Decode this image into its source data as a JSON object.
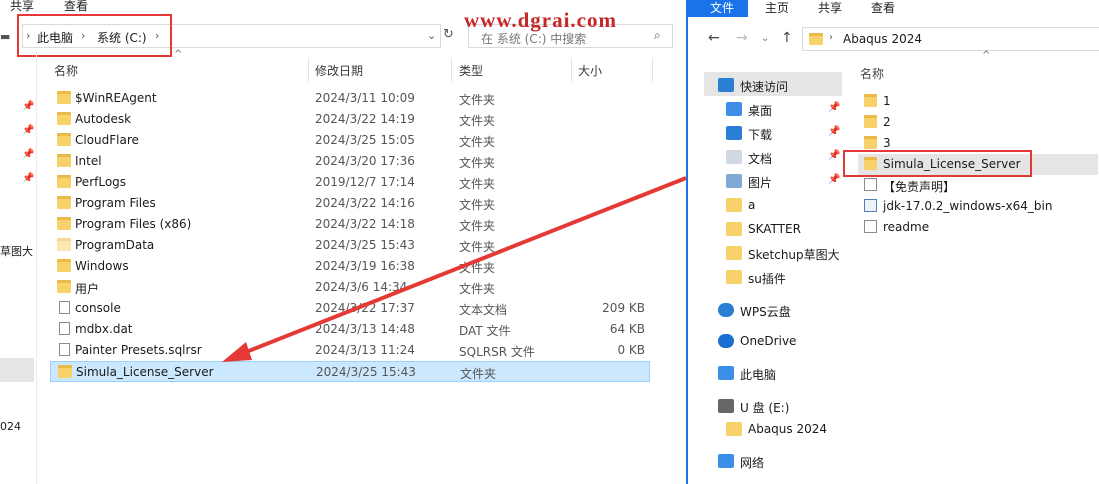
{
  "watermark": "www.dgrai.com",
  "left": {
    "ribbon": {
      "share": "共享",
      "view": "查看"
    },
    "breadcrumb": [
      "此电脑",
      "系统 (C:)"
    ],
    "search_placeholder": "在 系统 (C:) 中搜索",
    "columns": {
      "name": "名称",
      "date": "修改日期",
      "type": "类型",
      "size": "大小"
    },
    "side_fragments": [
      "草图大",
      "024"
    ],
    "files": [
      {
        "name": "$WinREAgent",
        "date": "2024/3/11 10:09",
        "type": "文件夹",
        "size": "",
        "icon": "folder"
      },
      {
        "name": "Autodesk",
        "date": "2024/3/22 14:19",
        "type": "文件夹",
        "size": "",
        "icon": "folder"
      },
      {
        "name": "CloudFlare",
        "date": "2024/3/25 15:05",
        "type": "文件夹",
        "size": "",
        "icon": "folder"
      },
      {
        "name": "Intel",
        "date": "2024/3/20 17:36",
        "type": "文件夹",
        "size": "",
        "icon": "folder"
      },
      {
        "name": "PerfLogs",
        "date": "2019/12/7 17:14",
        "type": "文件夹",
        "size": "",
        "icon": "folder"
      },
      {
        "name": "Program Files",
        "date": "2024/3/22 14:16",
        "type": "文件夹",
        "size": "",
        "icon": "folder"
      },
      {
        "name": "Program Files (x86)",
        "date": "2024/3/22 14:18",
        "type": "文件夹",
        "size": "",
        "icon": "folder"
      },
      {
        "name": "ProgramData",
        "date": "2024/3/25 15:43",
        "type": "文件夹",
        "size": "",
        "icon": "folder-pale"
      },
      {
        "name": "Windows",
        "date": "2024/3/19 16:38",
        "type": "文件夹",
        "size": "",
        "icon": "folder"
      },
      {
        "name": "用户",
        "date": "2024/3/6 14:34",
        "type": "文件夹",
        "size": "",
        "icon": "folder"
      },
      {
        "name": "console",
        "date": "2024/3/22 17:37",
        "type": "文本文档",
        "size": "209 KB",
        "icon": "file"
      },
      {
        "name": "mdbx.dat",
        "date": "2024/3/13 14:48",
        "type": "DAT 文件",
        "size": "64 KB",
        "icon": "file"
      },
      {
        "name": "Painter Presets.sqlrsr",
        "date": "2024/3/13 11:24",
        "type": "SQLRSR 文件",
        "size": "0 KB",
        "icon": "file"
      },
      {
        "name": "Simula_License_Server",
        "date": "2024/3/25 15:43",
        "type": "文件夹",
        "size": "",
        "icon": "folder"
      }
    ]
  },
  "right": {
    "ribbon": {
      "file": "文件",
      "home": "主页",
      "share": "共享",
      "view": "查看"
    },
    "address": "Abaqus 2024",
    "column_name": "名称",
    "nav": [
      {
        "label": "快速访问",
        "icon": "star-icon"
      },
      {
        "label": "桌面",
        "icon": "desktop-icon"
      },
      {
        "label": "下载",
        "icon": "download-icon"
      },
      {
        "label": "文档",
        "icon": "document-icon"
      },
      {
        "label": "图片",
        "icon": "picture-icon"
      },
      {
        "label": "a",
        "icon": "folder-icon"
      },
      {
        "label": "SKATTER",
        "icon": "folder-icon"
      },
      {
        "label": "Sketchup草图大",
        "icon": "folder-icon"
      },
      {
        "label": "su插件",
        "icon": "folder-icon"
      },
      {
        "label": "WPS云盘",
        "icon": "cloud-icon"
      },
      {
        "label": "OneDrive",
        "icon": "onedrive-icon"
      },
      {
        "label": "此电脑",
        "icon": "computer-icon"
      },
      {
        "label": "U 盘 (E:)",
        "icon": "usb-drive-icon"
      },
      {
        "label": "Abaqus 2024",
        "icon": "folder-icon"
      },
      {
        "label": "网络",
        "icon": "network-icon"
      }
    ],
    "items": [
      {
        "name": "1",
        "icon": "folder"
      },
      {
        "name": "2",
        "icon": "folder"
      },
      {
        "name": "3",
        "icon": "folder"
      },
      {
        "name": "Simula_License_Server",
        "icon": "folder"
      },
      {
        "name": "【免责声明】",
        "icon": "file"
      },
      {
        "name": "jdk-17.0.2_windows-x64_bin",
        "icon": "installer"
      },
      {
        "name": "readme",
        "icon": "file"
      }
    ]
  },
  "colors": {
    "accent": "#1a73e8",
    "highlight": "#e53935",
    "selection": "#cce8ff"
  }
}
